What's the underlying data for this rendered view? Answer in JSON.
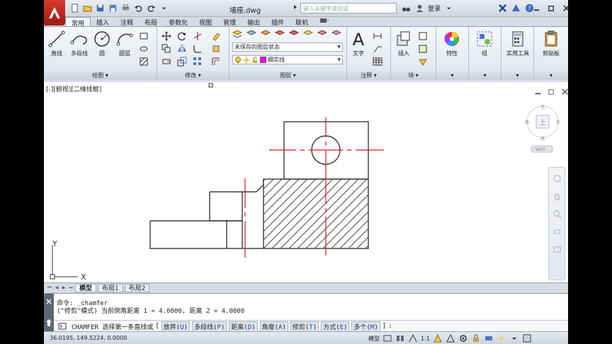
{
  "title_bar": {
    "document_title": "墙座.dwg",
    "search_placeholder": "键入关键字或短语",
    "login_label": "登录"
  },
  "ribbon_tabs": [
    "常用",
    "插入",
    "注释",
    "布局",
    "参数化",
    "视图",
    "管理",
    "输出",
    "插件",
    "联机"
  ],
  "active_tab": "常用",
  "panels": {
    "draw": {
      "title": "绘图",
      "line_label": "直线",
      "polyline_label": "多段线",
      "circle_label": "圆",
      "arc_label": "圆弧"
    },
    "modify": {
      "title": "修改"
    },
    "layers": {
      "title": "图层",
      "layer_state": "未保存的图层状态",
      "current_layer": "细实线",
      "layer_color": "#ff00ff"
    },
    "annotation": {
      "title": "注释",
      "text_label": "文字"
    },
    "block": {
      "title": "块",
      "insert_label": "插入"
    },
    "properties": {
      "label": "特性"
    },
    "groups": {
      "label": "组"
    },
    "utilities": {
      "label": "实用工具"
    },
    "clipboard": {
      "label": "剪贴板"
    }
  },
  "viewport": {
    "label": "[-][俯视][二维线框]",
    "wcs_label": "WCS",
    "ucs_x": "X",
    "ucs_y": "Y",
    "viewcube_top": "上",
    "viewcube_south": "南",
    "viewcube_west": "西",
    "viewcube_east": "东"
  },
  "layout_tabs": [
    "模型",
    "布局1",
    "布局2"
  ],
  "active_layout": "模型",
  "command": {
    "history_line1": "命令: _chamfer",
    "history_line2": "(\"修剪\"模式) 当前倒角距离 1 = 4.0000, 距离 2 = 4.0000",
    "prompt_prefix": "CHAMFER 选择第一条直线或",
    "options": [
      {
        "label": "放弃",
        "key": "U"
      },
      {
        "label": "多段线",
        "key": "P"
      },
      {
        "label": "距离",
        "key": "D"
      },
      {
        "label": "角度",
        "key": "A"
      },
      {
        "label": "修剪",
        "key": "T"
      },
      {
        "label": "方式",
        "key": "E"
      },
      {
        "label": "多个",
        "key": "M"
      }
    ],
    "prompt_suffix": ":"
  },
  "status_bar": {
    "coordinates": "36.0195,  149.5224, 0.0000",
    "model_label": "模型",
    "scale_label": "1:1"
  },
  "colors": {
    "center_line": "#e8101a",
    "geometry": "#1a1a1a",
    "hatch": "#333333",
    "app_button": "#c62a1d"
  }
}
